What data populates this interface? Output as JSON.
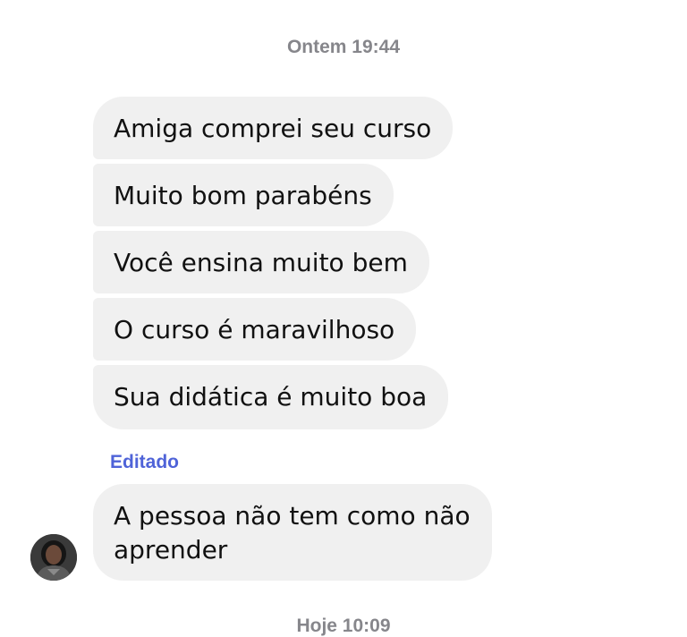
{
  "chat": {
    "timestamp_top": "Ontem 19:44",
    "messages": [
      {
        "text": "Amiga comprei seu curso"
      },
      {
        "text": "Muito bom parabéns"
      },
      {
        "text": "Você ensina muito bem"
      },
      {
        "text": "O curso é maravilhoso"
      },
      {
        "text": "Sua didática é muito boa"
      }
    ],
    "edited_label": "Editado",
    "last_message": {
      "text": "A pessoa não tem como não aprender"
    },
    "timestamp_bottom": "Hoje 10:09"
  },
  "colors": {
    "bubble_bg": "#f0f0f0",
    "timestamp_text": "#86868b",
    "edited_label": "#4f63d8",
    "message_text": "#111111"
  },
  "icons": {
    "avatar": "sender-avatar"
  }
}
